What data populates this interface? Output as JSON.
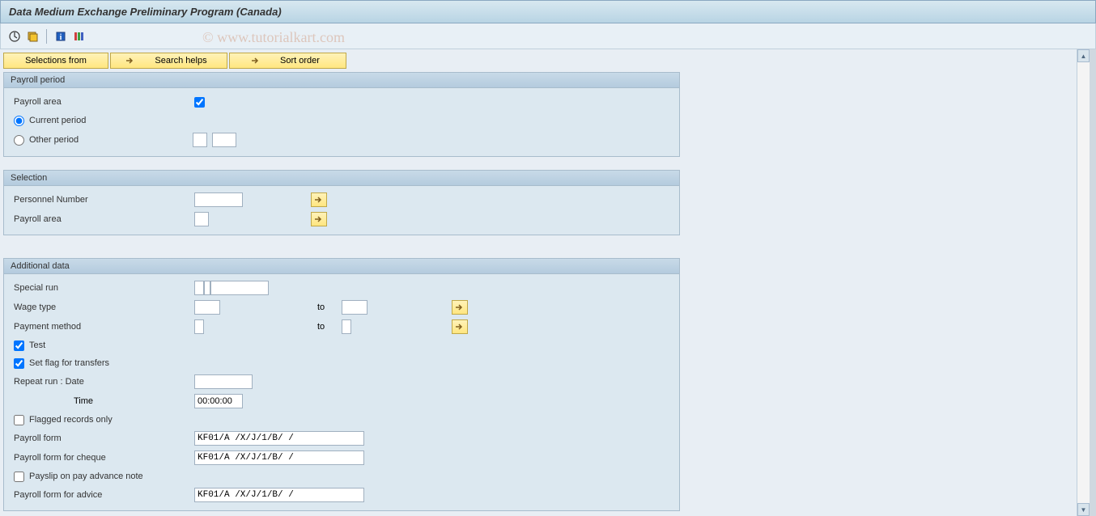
{
  "title": "Data Medium Exchange Preliminary Program (Canada)",
  "watermark": "© www.tutorialkart.com",
  "toolbar_buttons": {
    "selections_from": "Selections from",
    "search_helps": "Search helps",
    "sort_order": "Sort order"
  },
  "groups": {
    "payroll_period": {
      "title": "Payroll period",
      "payroll_area_label": "Payroll area",
      "current_period": "Current period",
      "other_period": "Other period"
    },
    "selection": {
      "title": "Selection",
      "personnel_number": "Personnel Number",
      "payroll_area": "Payroll area"
    },
    "additional": {
      "title": "Additional data",
      "special_run": "Special run",
      "wage_type": "Wage type",
      "to": "to",
      "payment_method": "Payment method",
      "test": "Test",
      "set_flag": "Set flag for transfers",
      "repeat_run": "Repeat run    : Date",
      "time": "Time",
      "time_value": "00:00:00",
      "flagged_only": "Flagged records only",
      "payroll_form": "Payroll form",
      "payroll_form_value": "KF01/A /X/J/1/B/ /",
      "payroll_form_cheque": "Payroll form for cheque",
      "payroll_form_cheque_value": "KF01/A /X/J/1/B/ /",
      "payslip_advance": "Payslip on pay advance note",
      "payroll_form_advice": "Payroll form for advice",
      "payroll_form_advice_value": "KF01/A /X/J/1/B/ /"
    }
  }
}
